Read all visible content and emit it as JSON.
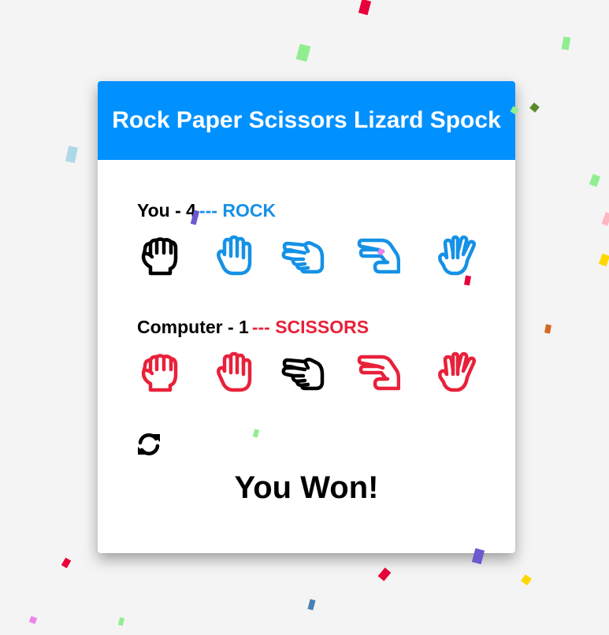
{
  "title": "Rock Paper Scissors Lizard Spock",
  "colors": {
    "header_bg": "#0091ff",
    "player": "#1591e6",
    "computer": "#e8213a",
    "selected": "#000000"
  },
  "player": {
    "label": "You - 4",
    "selection": "--- ROCK",
    "selected_choice": "rock"
  },
  "computer": {
    "label": "Computer - 1",
    "selection": "--- SCISSORS",
    "selected_choice": "scissors"
  },
  "choices": [
    {
      "id": "rock",
      "icon": "rock-hand-icon"
    },
    {
      "id": "paper",
      "icon": "paper-hand-icon"
    },
    {
      "id": "scissors",
      "icon": "scissors-hand-icon"
    },
    {
      "id": "lizard",
      "icon": "lizard-hand-icon"
    },
    {
      "id": "spock",
      "icon": "spock-hand-icon"
    }
  ],
  "reset_icon": "refresh-icon",
  "result": "You Won!"
}
